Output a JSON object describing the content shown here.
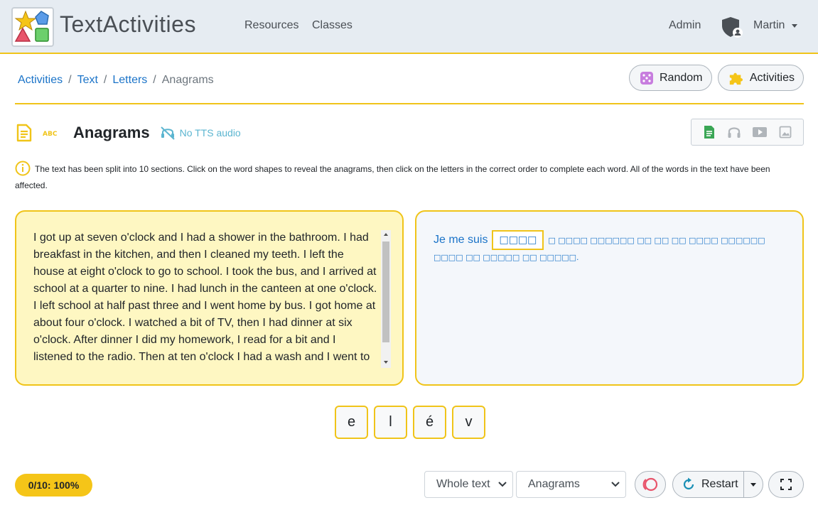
{
  "navbar": {
    "brand": "TextActivities",
    "links": [
      "Resources",
      "Classes"
    ],
    "admin": "Admin",
    "user": "Martin"
  },
  "breadcrumb": {
    "items": [
      "Activities",
      "Text",
      "Letters"
    ],
    "active": "Anagrams",
    "separator": "/"
  },
  "header_buttons": {
    "random": "Random",
    "activities": "Activities"
  },
  "activity": {
    "title": "Anagrams",
    "tts_status": "No TTS audio",
    "instructions": "The text has been split into 10 sections. Click on the word shapes to reveal the anagrams, then click on the letters in the correct order to complete each word. All of the words in the text have been affected."
  },
  "source_text": "I got up at seven o'clock and I had a shower in the bathroom. I had breakfast in the kitchen, and then I cleaned my teeth. I left the house at eight o'clock to go to school. I took the bus, and I arrived at school at a quarter to nine. I had lunch in the canteen at one o'clock. I left school at half past three and I went home by bus. I got home at about four o'clock. I watched a bit of TV, then I had dinner at six o'clock. After dinner I did my homework, I read for a bit and I listened to the radio. Then at ten o'clock I had a wash and I went to bed.",
  "answer": {
    "revealed": "Je me suis",
    "current_word_shape": "□□□□",
    "line1_rest": "□ □□□□ □□□□□□ □□ □□ □□ □□□□ □□□□□□",
    "line2": "□□□□ □□ □□□□□ □□ □□□□□."
  },
  "letter_tiles": [
    "e",
    "l",
    "é",
    "v"
  ],
  "footer": {
    "score": "0/10: 100%",
    "scope_select": "Whole text",
    "activity_select": "Anagrams",
    "restart": "Restart"
  },
  "colors": {
    "accent": "#f0c419",
    "link": "#1a73c8",
    "left_panel_bg": "#fef7c2",
    "navbar_bg": "#e6ecf2"
  },
  "icons": [
    "logo-icon",
    "shield-user-icon",
    "dice-icon",
    "puzzle-icon",
    "document-icon",
    "abc-icon",
    "no-audio-icon",
    "text-view-icon",
    "headphones-icon",
    "video-icon",
    "image-icon",
    "info-icon",
    "ring-icon",
    "restart-icon",
    "fullscreen-icon"
  ]
}
